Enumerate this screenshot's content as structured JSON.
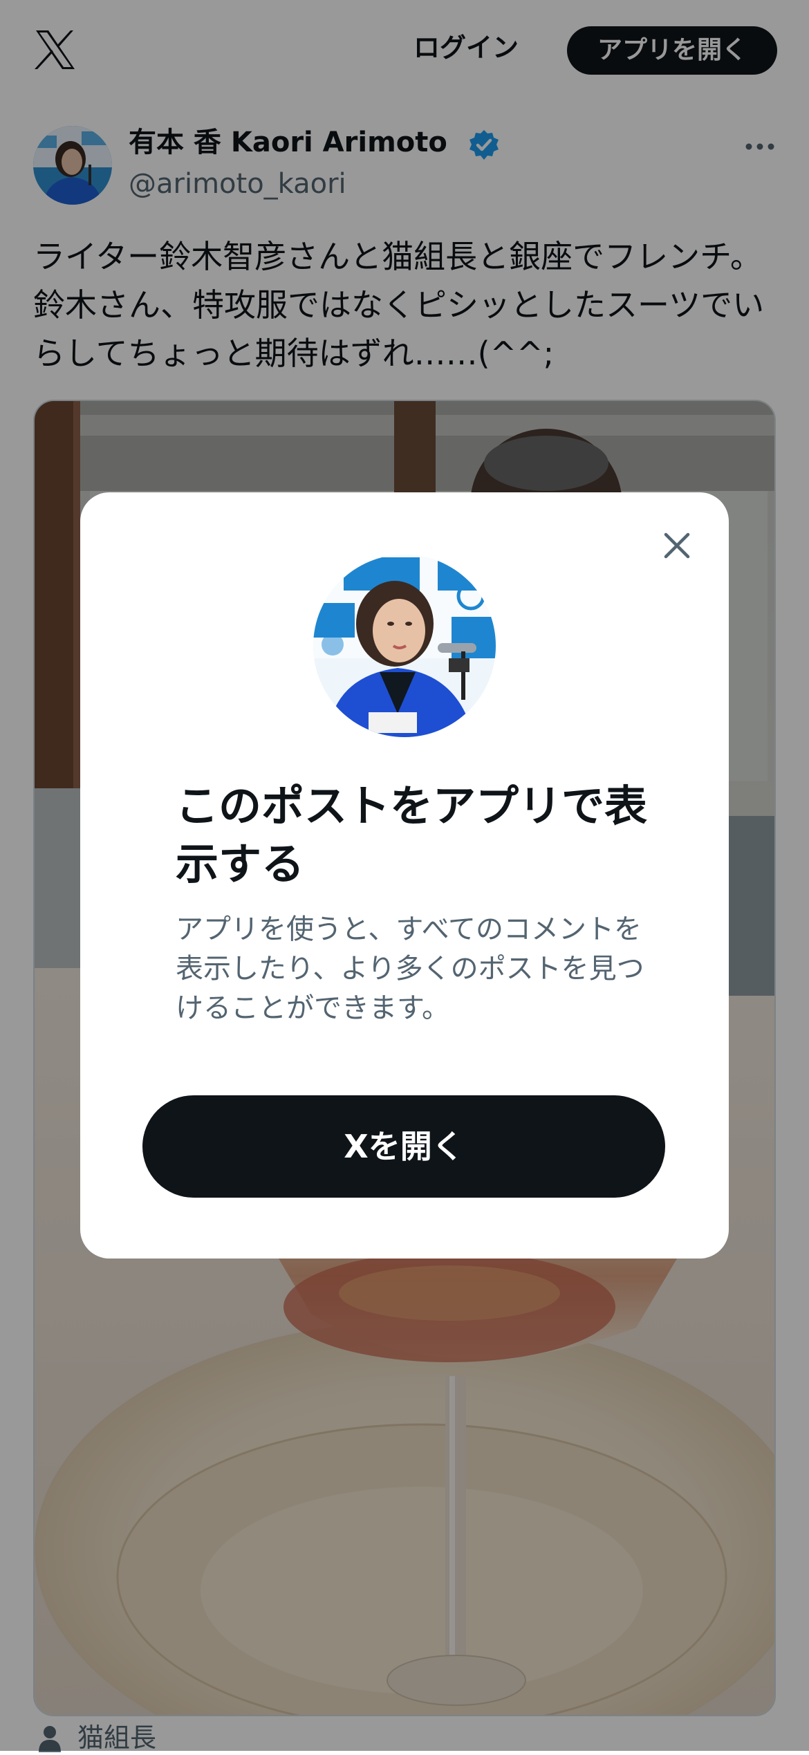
{
  "colors": {
    "text_primary": "#0f1419",
    "text_secondary": "#536471",
    "verified_blue": "#1d9bf0",
    "button_dark": "#0f1419"
  },
  "header": {
    "logo_icon": "x-logo-icon",
    "login_label": "ログイン",
    "open_app_label": "アプリを開く"
  },
  "post": {
    "author_name": "有本 香 Kaori Arimoto",
    "author_handle": "@arimoto_kaori",
    "verified_icon": "verified-badge-icon",
    "more_icon": "more-options-icon",
    "text": "ライター鈴木智彦さんと猫組長と銀座でフレンチ。鈴木さん、特攻服ではなくピシッとしたスーツでいらしてちょっと期待はずれ……(^^;",
    "tagged_user": "猫組長"
  },
  "modal": {
    "close_icon": "close-icon",
    "title": "このポストをアプリで表示する",
    "description": "アプリを使うと、すべてのコメントを表示したり、より多くのポストを見つけることができます。",
    "open_button_label": "Xを開く"
  }
}
